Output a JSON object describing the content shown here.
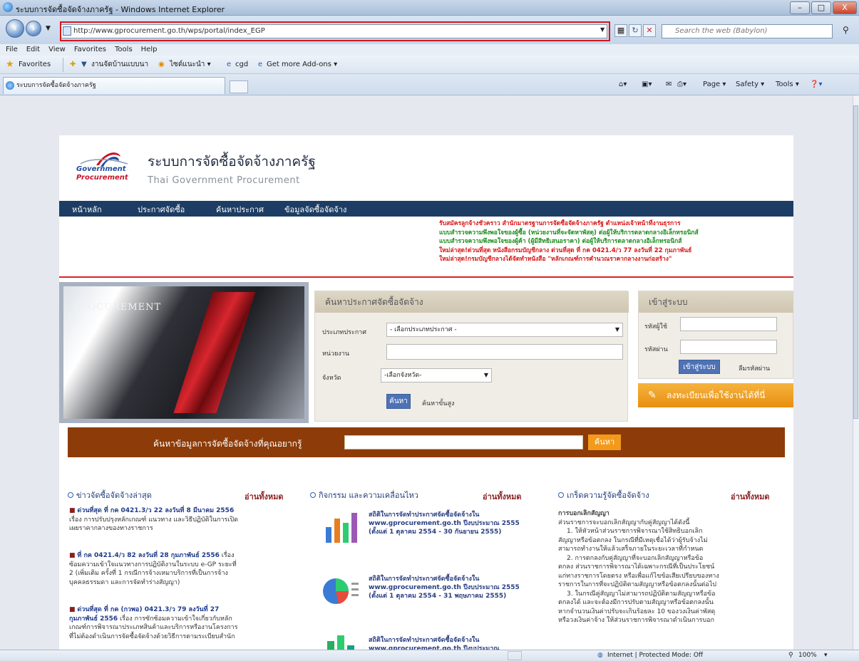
{
  "window": {
    "title": "ระบบการจัดซื้อจัดจ้างภาครัฐ - Windows Internet Explorer",
    "min": "–",
    "max": "□",
    "close": "X"
  },
  "address": {
    "url": "http://www.gprocurement.go.th/wps/portal/index_EGP",
    "search_placeholder": "Search the web (Babylon)"
  },
  "menu": [
    "File",
    "Edit",
    "View",
    "Favorites",
    "Tools",
    "Help"
  ],
  "favbar": {
    "favorites": "Favorites",
    "items": [
      "งานจัดบ้านแบบนา",
      "ไซต์แนะนำ ▾",
      "cgd",
      "Get more Add-ons ▾"
    ]
  },
  "tab": {
    "label": "ระบบการจัดซื้อจัดจ้างภาครัฐ"
  },
  "cmdbar": {
    "page": "Page ▾",
    "safety": "Safety ▾",
    "tools": "Tools ▾"
  },
  "status": {
    "zone": "Internet | Protected Mode: Off",
    "zoom": "100%"
  },
  "site": {
    "title_th": "ระบบการจัดซื้อจัดจ้างภาครัฐ",
    "title_en": "Thai Government Procurement",
    "logo_line1": "Government",
    "logo_line2": "Procurement"
  },
  "nav": [
    "หน้าหลัก",
    "ประกาศจัดซื้อ",
    "ค้นหาประกาศ",
    "ข้อมูลจัดซื้อจัดจ้าง"
  ],
  "marquee": [
    {
      "text": "รับสมัครลูกจ้างชั่วคราว สำนักมาตรฐานการจัดซื้อจัดจ้างภาครัฐ ตำแหน่งเจ้าหน้าที่งานธุรการ",
      "color": "#d81414"
    },
    {
      "text": "แบบสำรวจความพึงพอใจของผู้ซื้อ (หน่วยงานที่จะจัดหาพัสดุ) ต่อผู้ให้บริการตลาดกลางอิเล็กทรอนิกส์",
      "color": "#1a8a1a"
    },
    {
      "text": "แบบสำรวจความพึงพอใจของผู้ค้า (ผู้มีสิทธิเสนอราคา) ต่อผู้ให้บริการตลาดกลางอิเล็กทรอนิกส์",
      "color": "#1a8a1a"
    },
    {
      "text": "ใหม่ล่าสุด!ด่วนที่สุด หนังสือกรมบัญชีกลาง ด่วนที่สุด ที่ กค 0421.4/ว 77 ลงวันที่ 22 กุมภาพันธ์",
      "color": "#d81414"
    },
    {
      "text": "ใหม่ล่าสุด!กรมบัญชีกลางได้จัดทำหนังสือ \"หลักเกณฑ์การคำนวณราคากลางงานก่อสร้าง\"",
      "color": "#d81414"
    }
  ],
  "hero": {
    "caption": "PROCUREMENT"
  },
  "search": {
    "header": "ค้นหาประกาศจัดซื้อจัดจ้าง",
    "type_label": "ประเภทประกาศ",
    "type_value": "- เลือกประเภทประกาศ -",
    "agency_label": "หน่วยงาน",
    "agency_value": "",
    "province_label": "จังหวัด",
    "province_value": "-เลือกจังหวัด-",
    "search_btn": "ค้นหา",
    "advanced": "ค้นหาขั้นสูง"
  },
  "login": {
    "header": "เข้าสู่ระบบ",
    "user_label": "รหัสผู้ใช้",
    "pass_label": "รหัสผ่าน",
    "login_btn": "เข้าสู่ระบบ",
    "forgot": "ลืมรหัสผ่าน"
  },
  "register": {
    "label": "ลงทะเบียนเพื่อใช้งานได้ที่นี่"
  },
  "band": {
    "label": "ค้นหาข้อมูลการจัดซื้อจัดจ้างที่คุณอยากรู้",
    "btn": "ค้นหา"
  },
  "columns": {
    "news_hd": "ข่าวจัดซื้อจัดจ้างล่าสุด",
    "act_hd": "กิจกรรม และความเคลื่อนไหว",
    "know_hd": "เกร็ดความรู้จัดซื้อจัดจ้าง",
    "read_all": "อ่านทั้งหมด"
  },
  "news": [
    {
      "title": "ด่วนที่สุด ที่ กค 0421.3/ว 22 ลงวันที่ 8 มีนาคม 2556",
      "body": "เรื่อง การปรับปรุงหลักเกณฑ์ แนวทาง และวิธีปฏิบัติในการเปิดเผยราคากลางของทางราชการ"
    },
    {
      "title": "ที่ กค 0421.4/ว 82 ลงวันที่ 28 กุมภาพันธ์ 2556",
      "body": "เรื่อง ซ้อมความเข้าใจแนวทางการปฏิบัติงานในระบบ e-GP ระยะที่ 2 (เพิ่มเติม ครั้งที่ 1 กรณีการจ้างเหมาบริการที่เป็นการจ้างบุคคลธรรมดา และการจัดทำร่างสัญญา)"
    },
    {
      "title": "ด่วนที่สุด ที่ กค (กวพอ) 0421.3/ว 79 ลงวันที่ 27 กุมภาพันธ์ 2556",
      "body": "เรื่อง การซักซ้อมความเข้าใจเกี่ยวกับหลักเกณฑ์การพิจารณาประเภทสินค้าและบริการหรืองานโครงการที่ไม่ต้องดำเนินการจัดซื้อจัดจ้างด้วยวิธีการตามระเบียบสำนัก"
    }
  ],
  "activities": [
    {
      "text": "สถิติในการจัดทำประกาศจัดซื้อจัดจ้างใน www.gprocurement.go.th ปีงบประมาณ 2555 (ตั้งแต่ 1 ตุลาคม 2554 - 30 กันยายน 2555)"
    },
    {
      "text": "สถิติในการจัดทำประกาศจัดซื้อจัดจ้างใน www.gprocurement.go.th ปีงบประมาณ 2555 (ตั้งแต่ 1 ตุลาคม 2554 - 31 พฤษภาคม 2555)"
    },
    {
      "text": "สถิติในการจัดทำประกาศจัดซื้อจัดจ้างใน www.gprocurement.go.th ปีงบประมาณ"
    }
  ],
  "knowledge": {
    "title": "การบอกเลิกสัญญา",
    "lines": [
      "ส่วนราชการจะบอกเลิกสัญญากับคู่สัญญาได้ดังนี้",
      "1. ให้หัวหน้าส่วนราชการพิจารณาใช้สิทธิบอกเลิก",
      "สัญญาหรือข้อตกลง ในกรณีที่มีเหตุเชื่อได้ว่าผู้รับจ้างไม่",
      "สามารถทำงานให้แล้วเสร็จภายในระยะเวลาที่กำหนด",
      "2. การตกลงกับคู่สัญญาที่จะบอกเลิกสัญญาหรือข้อ",
      "ตกลง ส่วนราชการพิจารณาได้เฉพาะกรณีที่เป็นประโยชน์",
      "แก่ทางราชการโดยตรง หรือเพื่อแก้ไขข้อเสียเปรียบของทาง",
      "ราชการในการที่จะปฏิบัติตามสัญญาหรือข้อตกลงนั้นต่อไป",
      "3. ในกรณีคู่สัญญาไม่สามารถปฏิบัติตามสัญญาหรือข้อ",
      "ตกลงได้ และจะต้องมีการปรับตามสัญญาหรือข้อตกลงนั้น",
      "หากจำนวนเงินค่าปรับจะเกินร้อยละ 10 ของวงเงินค่าพัสดุ",
      "หรือวงเงินค่าจ้าง ให้ส่วนราชการพิจารณาดำเนินการบอก"
    ]
  }
}
